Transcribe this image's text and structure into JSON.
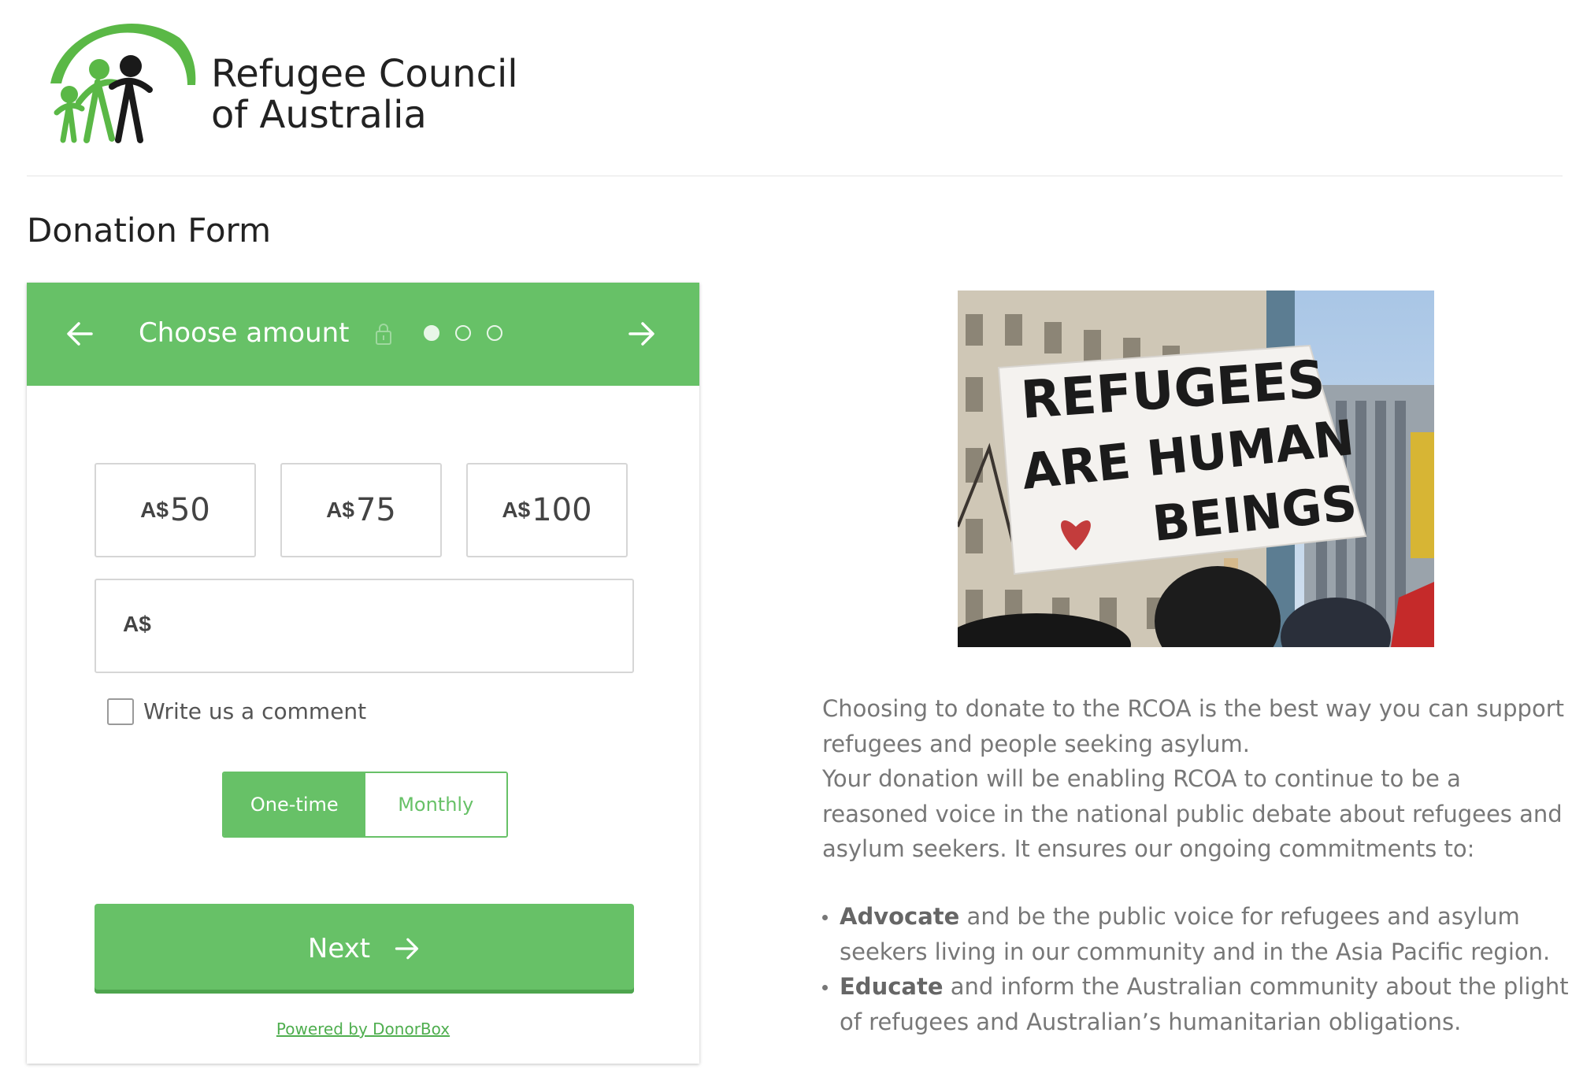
{
  "org": {
    "name_line1": "Refugee Council",
    "name_line2": "of Australia"
  },
  "page_title": "Donation Form",
  "widget": {
    "header_title": "Choose amount",
    "steps_total": 3,
    "step_current": 1,
    "amounts": [
      {
        "currency": "A$",
        "value": "50"
      },
      {
        "currency": "A$",
        "value": "75"
      },
      {
        "currency": "A$",
        "value": "100"
      }
    ],
    "custom_amount": {
      "currency": "A$",
      "value": "",
      "placeholder": ""
    },
    "comment_label": "Write us a comment",
    "comment_checked": false,
    "frequency": {
      "one_time": "One-time",
      "monthly": "Monthly",
      "selected": "One-time"
    },
    "next_label": "Next",
    "powered_by": "Powered by DonorBox"
  },
  "photo": {
    "sign_line1": "REFUGEES",
    "sign_line2": "ARE HUMAN",
    "sign_line3": "BEINGS"
  },
  "description": {
    "para1": "Choosing to donate to the RCOA is the best way you can support refugees and people seeking asylum.",
    "para2": "Your donation will be enabling RCOA to continue to be a reasoned voice in the national public debate about refugees and asylum seekers. It ensures our ongoing commitments to:",
    "bullets": [
      {
        "bold": "Advocate",
        "text": " and be the public voice for refugees and asylum seekers living in our community and in the Asia Pacific region."
      },
      {
        "bold": "Educate",
        "text": " and inform the Australian community about the plight of refugees and Australian’s humanitarian obligations."
      }
    ]
  },
  "colors": {
    "brand_green": "#67c167",
    "logo_green": "#5ab846",
    "text_gray": "#777777"
  },
  "icons": {
    "back": "arrow-left-icon",
    "next": "arrow-right-icon",
    "lock": "lock-icon"
  }
}
